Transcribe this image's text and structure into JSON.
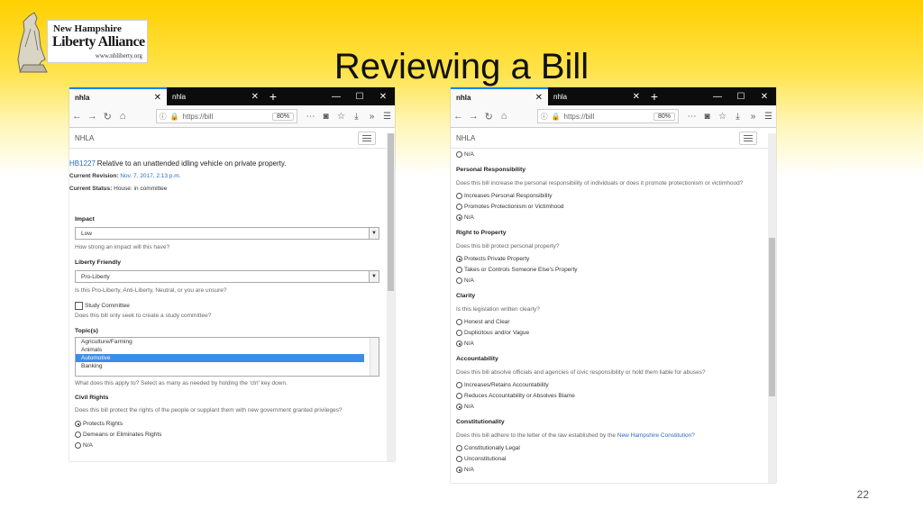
{
  "logo": {
    "line1": "New Hampshire",
    "line2": "Liberty Alliance",
    "line3": "www.nhliberty.org"
  },
  "slide": {
    "title": "Reviewing a Bill",
    "page_number": "22"
  },
  "browser": {
    "tab1": "nhla",
    "tab2": "nhla",
    "url": "https://bill",
    "zoom": "80%",
    "site_name": "NHLA"
  },
  "left": {
    "bill_id": "HB1227",
    "bill_title": "Relative to an unattended idling vehicle on private property.",
    "revision_label": "Current Revision:",
    "revision_value": "Nov. 7, 2017, 2:13 p.m.",
    "status_label": "Current Status:",
    "status_value": "House: in committee",
    "impact_label": "Impact",
    "impact_value": "Low",
    "impact_help": "How strong an impact will this have?",
    "friendly_label": "Liberty Friendly",
    "friendly_value": "Pro-Liberty",
    "friendly_help": "Is this Pro-Liberty, Anti-Liberty, Neutral, or you are unsure?",
    "study_label": "Study Committee",
    "study_help": "Does this bill only seek to create a study committee?",
    "topics_label": "Topic(s)",
    "topics": [
      "Agriculture/Farming",
      "Animals",
      "Automotive",
      "Banking"
    ],
    "topics_help": "What does this apply to? Select as many as needed by holding the 'ctrl' key down.",
    "civil_label": "Civil Rights",
    "civil_help": "Does this bill protect the rights of the people or supplant them with new government granted privileges?",
    "civil_opt1": "Protects Rights",
    "civil_opt2": "Demeans or Eliminates Rights",
    "civil_opt3": "N/A"
  },
  "right": {
    "top_na": "N/A",
    "pr_label": "Personal Responsibility",
    "pr_help": "Does this bill increase the personal responsibility of individuals or does it promote protectionism or victimhood?",
    "pr_opt1": "Increases Personal Responsibility",
    "pr_opt2": "Promotes Protectionism or Victimhood",
    "pr_opt3": "N/A",
    "rp_label": "Right to Property",
    "rp_help": "Does this bill protect personal property?",
    "rp_opt1": "Protects Private Property",
    "rp_opt2": "Takes or Controls Someone Else's Property",
    "rp_opt3": "N/A",
    "cl_label": "Clarity",
    "cl_help": "Is this legislation written clearly?",
    "cl_opt1": "Honest and Clear",
    "cl_opt2": "Duplicitous and/or Vague",
    "cl_opt3": "N/A",
    "ac_label": "Accountability",
    "ac_help": "Does this bill absolve officials and agencies of civic responsibility or hold them liable for abuses?",
    "ac_opt1": "Increases/Retains Accountability",
    "ac_opt2": "Reduces Accountability or Absolves Blame",
    "ac_opt3": "N/A",
    "co_label": "Constitutionality",
    "co_help_pre": "Does this bill adhere to the letter of the law established by the",
    "co_help_link": "New Hampshire Constitution?",
    "co_opt1": "Constitutionally Legal",
    "co_opt2": "Unconstitutional",
    "co_opt3": "N/A"
  }
}
